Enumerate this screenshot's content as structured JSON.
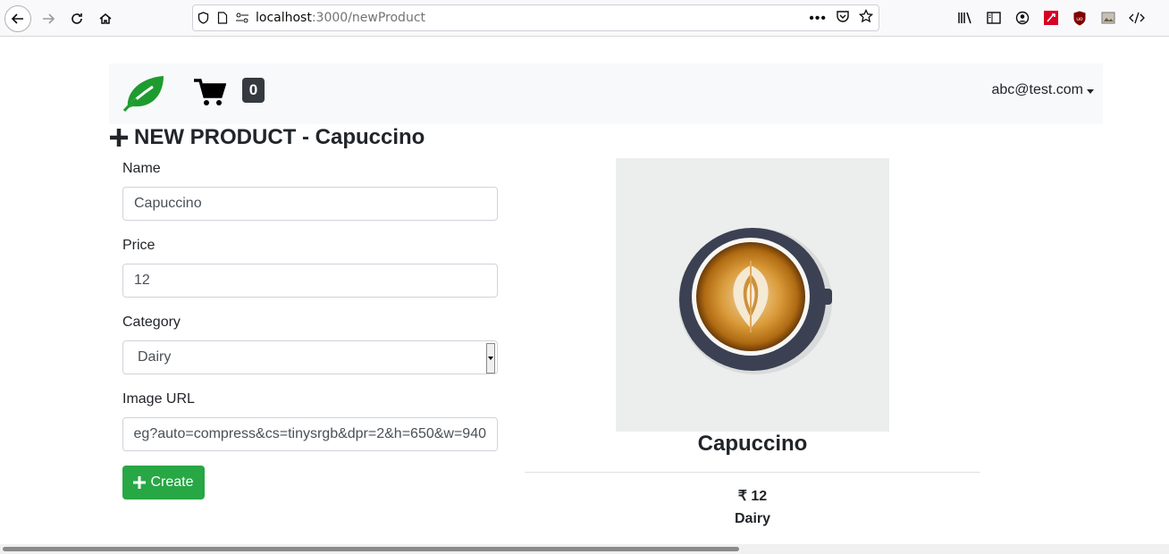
{
  "browser": {
    "url_host": "localhost",
    "url_path": ":3000/newProduct"
  },
  "navbar": {
    "cart_count": "0",
    "user_email": "abc@test.com"
  },
  "page": {
    "title": "NEW PRODUCT - Capuccino"
  },
  "form": {
    "name_label": "Name",
    "name_value": "Capuccino",
    "price_label": "Price",
    "price_value": "12",
    "category_label": "Category",
    "category_value": "Dairy",
    "image_url_label": "Image URL",
    "image_url_value": "eg?auto=compress&cs=tinysrgb&dpr=2&h=650&w=940",
    "create_label": "Create"
  },
  "preview": {
    "name": "Capuccino",
    "price": "₹ 12",
    "category": "Dairy"
  },
  "colors": {
    "brand_green": "#28a745",
    "leaf_green": "#1e9b2e",
    "navbar_bg": "#f8f9fa",
    "badge_dark": "#343a40"
  }
}
